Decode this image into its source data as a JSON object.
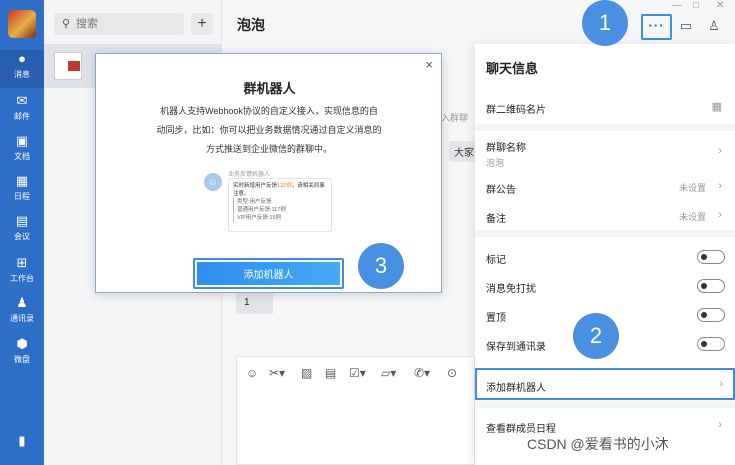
{
  "nav": {
    "items": [
      {
        "label": "消息",
        "icon": "chat-bubble-icon"
      },
      {
        "label": "邮件",
        "icon": "mail-icon"
      },
      {
        "label": "文档",
        "icon": "document-icon"
      },
      {
        "label": "日程",
        "icon": "calendar-icon"
      },
      {
        "label": "会议",
        "icon": "meeting-icon"
      },
      {
        "label": "工作台",
        "icon": "workbench-icon"
      },
      {
        "label": "通讯录",
        "icon": "contacts-icon"
      },
      {
        "label": "微盘",
        "icon": "drive-icon"
      }
    ]
  },
  "conv": {
    "search_placeholder": "搜索",
    "add_label": "+"
  },
  "chat": {
    "title": "泡泡",
    "sys_note": "入群聊",
    "bubble_text": "大家",
    "message_text": "1"
  },
  "header": {
    "more_label": "···"
  },
  "panel": {
    "title": "聊天信息",
    "qr_label": "群二维码名片",
    "group_name_label": "群聊名称",
    "group_name_value": "泡泡",
    "announcement_label": "群公告",
    "announcement_value": "未设置",
    "remark_label": "备注",
    "remark_value": "未设置",
    "toggles": {
      "mark": "标记",
      "mute": "消息免打扰",
      "pin": "置顶",
      "save_contacts": "保存到通讯录"
    },
    "add_bot_label": "添加群机器人",
    "schedule_label": "查看群成员日程",
    "chevron": "›"
  },
  "modal": {
    "title": "群机器人",
    "desc": "机器人支持Webhook协议的自定义接入，实现信息的自动同步，比如：你可以把业务数据情况通过自定义消息的方式推送到企业微信的群聊中。",
    "preview": {
      "bot_name": "业务反馈机器人",
      "line1_pre": "实时新增用户反馈",
      "line1_hl": "132例",
      "line1_post": "，请相关同事注意。",
      "line2": "类型:用户反馈",
      "line3": "普通用户反馈:117例",
      "line4": "VIP用户反馈:15例"
    },
    "button_label": "添加机器人",
    "close_label": "×"
  },
  "badges": [
    "1",
    "2",
    "3"
  ],
  "watermark": "CSDN @爱看书的小沐"
}
